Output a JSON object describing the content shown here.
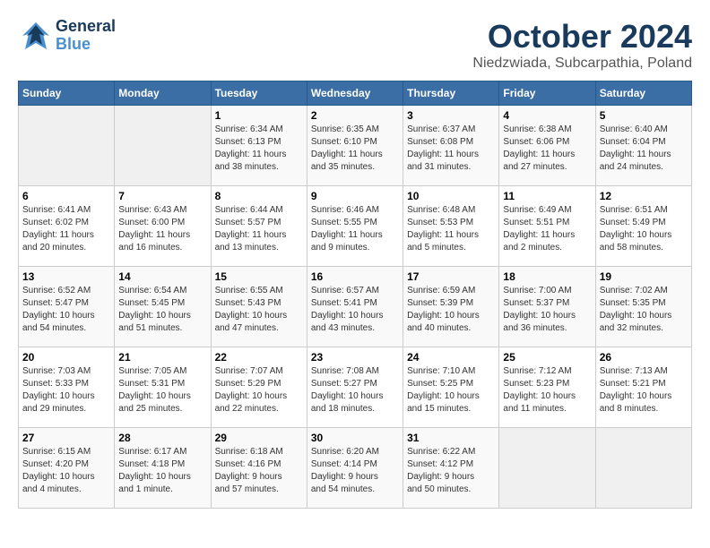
{
  "header": {
    "logo_general": "General",
    "logo_blue": "Blue",
    "title": "October 2024",
    "subtitle": "Niedzwiada, Subcarpathia, Poland"
  },
  "weekdays": [
    "Sunday",
    "Monday",
    "Tuesday",
    "Wednesday",
    "Thursday",
    "Friday",
    "Saturday"
  ],
  "weeks": [
    [
      {
        "day": "",
        "info": ""
      },
      {
        "day": "",
        "info": ""
      },
      {
        "day": "1",
        "info": "Sunrise: 6:34 AM\nSunset: 6:13 PM\nDaylight: 11 hours\nand 38 minutes."
      },
      {
        "day": "2",
        "info": "Sunrise: 6:35 AM\nSunset: 6:10 PM\nDaylight: 11 hours\nand 35 minutes."
      },
      {
        "day": "3",
        "info": "Sunrise: 6:37 AM\nSunset: 6:08 PM\nDaylight: 11 hours\nand 31 minutes."
      },
      {
        "day": "4",
        "info": "Sunrise: 6:38 AM\nSunset: 6:06 PM\nDaylight: 11 hours\nand 27 minutes."
      },
      {
        "day": "5",
        "info": "Sunrise: 6:40 AM\nSunset: 6:04 PM\nDaylight: 11 hours\nand 24 minutes."
      }
    ],
    [
      {
        "day": "6",
        "info": "Sunrise: 6:41 AM\nSunset: 6:02 PM\nDaylight: 11 hours\nand 20 minutes."
      },
      {
        "day": "7",
        "info": "Sunrise: 6:43 AM\nSunset: 6:00 PM\nDaylight: 11 hours\nand 16 minutes."
      },
      {
        "day": "8",
        "info": "Sunrise: 6:44 AM\nSunset: 5:57 PM\nDaylight: 11 hours\nand 13 minutes."
      },
      {
        "day": "9",
        "info": "Sunrise: 6:46 AM\nSunset: 5:55 PM\nDaylight: 11 hours\nand 9 minutes."
      },
      {
        "day": "10",
        "info": "Sunrise: 6:48 AM\nSunset: 5:53 PM\nDaylight: 11 hours\nand 5 minutes."
      },
      {
        "day": "11",
        "info": "Sunrise: 6:49 AM\nSunset: 5:51 PM\nDaylight: 11 hours\nand 2 minutes."
      },
      {
        "day": "12",
        "info": "Sunrise: 6:51 AM\nSunset: 5:49 PM\nDaylight: 10 hours\nand 58 minutes."
      }
    ],
    [
      {
        "day": "13",
        "info": "Sunrise: 6:52 AM\nSunset: 5:47 PM\nDaylight: 10 hours\nand 54 minutes."
      },
      {
        "day": "14",
        "info": "Sunrise: 6:54 AM\nSunset: 5:45 PM\nDaylight: 10 hours\nand 51 minutes."
      },
      {
        "day": "15",
        "info": "Sunrise: 6:55 AM\nSunset: 5:43 PM\nDaylight: 10 hours\nand 47 minutes."
      },
      {
        "day": "16",
        "info": "Sunrise: 6:57 AM\nSunset: 5:41 PM\nDaylight: 10 hours\nand 43 minutes."
      },
      {
        "day": "17",
        "info": "Sunrise: 6:59 AM\nSunset: 5:39 PM\nDaylight: 10 hours\nand 40 minutes."
      },
      {
        "day": "18",
        "info": "Sunrise: 7:00 AM\nSunset: 5:37 PM\nDaylight: 10 hours\nand 36 minutes."
      },
      {
        "day": "19",
        "info": "Sunrise: 7:02 AM\nSunset: 5:35 PM\nDaylight: 10 hours\nand 32 minutes."
      }
    ],
    [
      {
        "day": "20",
        "info": "Sunrise: 7:03 AM\nSunset: 5:33 PM\nDaylight: 10 hours\nand 29 minutes."
      },
      {
        "day": "21",
        "info": "Sunrise: 7:05 AM\nSunset: 5:31 PM\nDaylight: 10 hours\nand 25 minutes."
      },
      {
        "day": "22",
        "info": "Sunrise: 7:07 AM\nSunset: 5:29 PM\nDaylight: 10 hours\nand 22 minutes."
      },
      {
        "day": "23",
        "info": "Sunrise: 7:08 AM\nSunset: 5:27 PM\nDaylight: 10 hours\nand 18 minutes."
      },
      {
        "day": "24",
        "info": "Sunrise: 7:10 AM\nSunset: 5:25 PM\nDaylight: 10 hours\nand 15 minutes."
      },
      {
        "day": "25",
        "info": "Sunrise: 7:12 AM\nSunset: 5:23 PM\nDaylight: 10 hours\nand 11 minutes."
      },
      {
        "day": "26",
        "info": "Sunrise: 7:13 AM\nSunset: 5:21 PM\nDaylight: 10 hours\nand 8 minutes."
      }
    ],
    [
      {
        "day": "27",
        "info": "Sunrise: 6:15 AM\nSunset: 4:20 PM\nDaylight: 10 hours\nand 4 minutes."
      },
      {
        "day": "28",
        "info": "Sunrise: 6:17 AM\nSunset: 4:18 PM\nDaylight: 10 hours\nand 1 minute."
      },
      {
        "day": "29",
        "info": "Sunrise: 6:18 AM\nSunset: 4:16 PM\nDaylight: 9 hours\nand 57 minutes."
      },
      {
        "day": "30",
        "info": "Sunrise: 6:20 AM\nSunset: 4:14 PM\nDaylight: 9 hours\nand 54 minutes."
      },
      {
        "day": "31",
        "info": "Sunrise: 6:22 AM\nSunset: 4:12 PM\nDaylight: 9 hours\nand 50 minutes."
      },
      {
        "day": "",
        "info": ""
      },
      {
        "day": "",
        "info": ""
      }
    ]
  ]
}
